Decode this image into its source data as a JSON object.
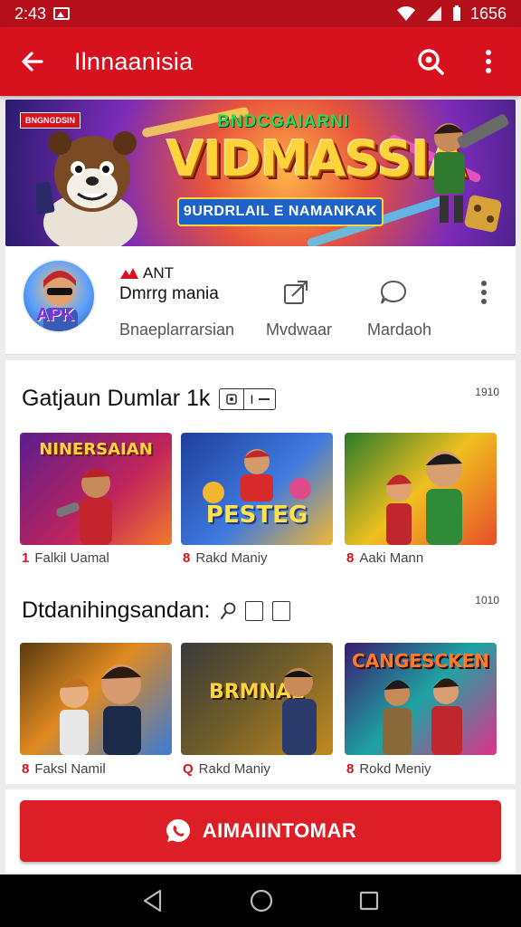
{
  "status_bar": {
    "time": "2:43",
    "battery": "1656"
  },
  "app_bar": {
    "title": "Ilnnaanisia"
  },
  "banner": {
    "sticker": "BNGNGDSIN",
    "super_title": "BNDCGAIARNI",
    "headline": "VIDMASSIA",
    "ribbon": "9URDRLAIL E NAMANKAK"
  },
  "app_info": {
    "avatar_label": "APK",
    "developer": "ANT",
    "subtitle": "Dmrrg mania",
    "meta_1": "Bnaeplarrarsian",
    "meta_2": "Mvdwaar",
    "meta_3": "Mardaoh"
  },
  "section_1": {
    "title": "Gatjaun Dumlar 1k",
    "pill_label": "I",
    "count": "1910",
    "items": [
      {
        "rank": "1",
        "label": "Falkil Uamal",
        "art_text": "NINERSAIAN"
      },
      {
        "rank": "8",
        "label": "Rakd Maniy",
        "art_text": "PESTEG"
      },
      {
        "rank": "8",
        "label": "Aaki Mann",
        "art_text": ""
      }
    ]
  },
  "section_2": {
    "title": "Dtdanihingsandan:",
    "count": "1010",
    "items": [
      {
        "rank": "8",
        "label": "Faksl Namil",
        "art_text": ""
      },
      {
        "rank": "Q",
        "label": "Rakd Maniy",
        "art_text": "BRMNAE"
      },
      {
        "rank": "8",
        "label": "Rokd Meniy",
        "art_text": "CANGESCKEN"
      }
    ]
  },
  "install_button": {
    "label": "AIMAIINTOMAR"
  },
  "colors": {
    "primary": "#d7121e",
    "status_bar": "#b5101a",
    "button": "#dc1f26"
  }
}
